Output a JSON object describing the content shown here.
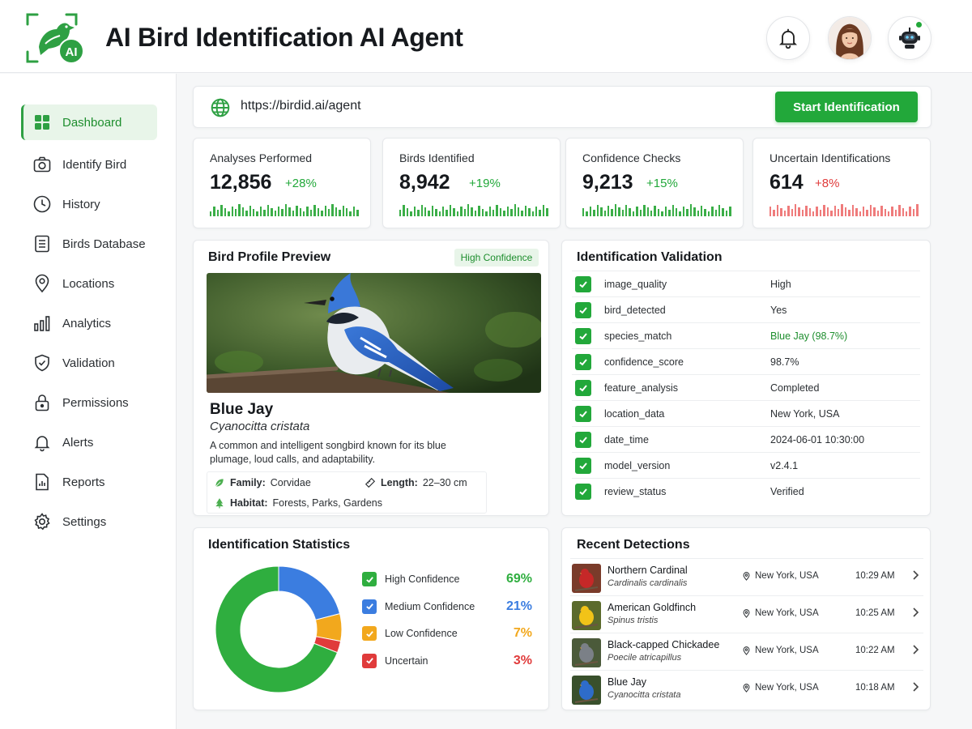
{
  "header": {
    "logo_badge": "AI",
    "title": "AI Bird Identification AI Agent",
    "notifications_icon": "bell-icon",
    "agent_icon": "robot-icon"
  },
  "sidebar": {
    "items": [
      {
        "label": "Dashboard",
        "icon": "grid-icon",
        "active": true
      },
      {
        "label": "Identify Bird",
        "icon": "camera-icon"
      },
      {
        "label": "History",
        "icon": "clock-icon"
      },
      {
        "label": "Birds Database",
        "icon": "list-icon"
      },
      {
        "label": "Locations",
        "icon": "pin-icon"
      },
      {
        "label": "Analytics",
        "icon": "bar-chart-icon"
      },
      {
        "label": "Validation",
        "icon": "shield-check-icon"
      },
      {
        "label": "Permissions",
        "icon": "lock-icon"
      },
      {
        "label": "Alerts",
        "icon": "bell-icon"
      },
      {
        "label": "Reports",
        "icon": "report-icon"
      },
      {
        "label": "Settings",
        "icon": "gear-icon"
      }
    ]
  },
  "url_bar": {
    "url": "https://birdid.ai/agent",
    "start_button": "Start Identification"
  },
  "stats": [
    {
      "label": "Analyses Performed",
      "value": "12,856",
      "change": "+28%",
      "trend": "up"
    },
    {
      "label": "Birds Identified",
      "value": "8,942",
      "change": "+19%",
      "trend": "up"
    },
    {
      "label": "Confidence Checks",
      "value": "9,213",
      "change": "+15%",
      "trend": "up"
    },
    {
      "label": "Uncertain Identifications",
      "value": "614",
      "change": "+8%",
      "trend": "down"
    }
  ],
  "profile": {
    "title": "Bird Profile Preview",
    "badge": "High Confidence",
    "name": "Blue Jay",
    "scientific": "Cyanocitta cristata",
    "description": "A common and intelligent songbird known for its blue plumage, loud calls, and adaptability.",
    "family_label": "Family:",
    "family": "Corvidae",
    "length_label": "Length:",
    "length": "22–30 cm",
    "habitat_label": "Habitat:",
    "habitat": "Forests, Parks, Gardens"
  },
  "validation": {
    "title": "Identification Validation",
    "rows": [
      {
        "key": "image_quality",
        "value": "High"
      },
      {
        "key": "bird_detected",
        "value": "Yes"
      },
      {
        "key": "species_match",
        "value": "Blue Jay (98.7%)",
        "highlight": true
      },
      {
        "key": "confidence_score",
        "value": "98.7%"
      },
      {
        "key": "feature_analysis",
        "value": "Completed"
      },
      {
        "key": "location_data",
        "value": "New York, USA"
      },
      {
        "key": "date_time",
        "value": "2024-06-01 10:30:00"
      },
      {
        "key": "model_version",
        "value": "v2.4.1"
      },
      {
        "key": "review_status",
        "value": "Verified"
      }
    ]
  },
  "statistics": {
    "title": "Identification Statistics",
    "chart_data": {
      "type": "pie",
      "labels": [
        "High Confidence",
        "Medium Confidence",
        "Low Confidence",
        "Uncertain"
      ],
      "values": [
        69,
        21,
        7,
        3
      ],
      "display": [
        "69%",
        "21%",
        "7%",
        "3%"
      ],
      "colors": [
        "#2fae3f",
        "#3b7de0",
        "#f2a81d",
        "#e03b3b"
      ]
    }
  },
  "recent": {
    "title": "Recent Detections",
    "rows": [
      {
        "name": "Northern Cardinal",
        "scientific": "Cardinalis cardinalis",
        "location": "New York, USA",
        "time": "10:29 AM"
      },
      {
        "name": "American Goldfinch",
        "scientific": "Spinus tristis",
        "location": "New York, USA",
        "time": "10:25 AM"
      },
      {
        "name": "Black-capped Chickadee",
        "scientific": "Poecile atricapillus",
        "location": "New York, USA",
        "time": "10:22 AM"
      },
      {
        "name": "Blue Jay",
        "scientific": "Cyanocitta cristata",
        "location": "New York, USA",
        "time": "10:18 AM"
      }
    ]
  }
}
